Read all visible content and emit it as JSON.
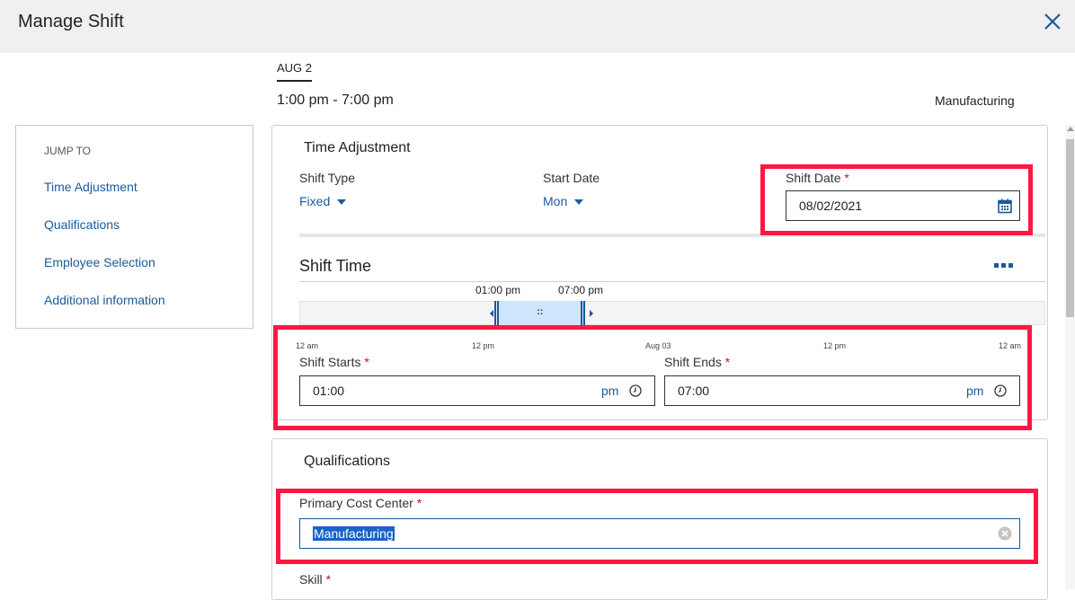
{
  "header": {
    "title": "Manage Shift",
    "close_icon": "close-icon"
  },
  "tab": {
    "date": "AUG 2"
  },
  "shift_summary": {
    "time_range": "1:00 pm - 7:00 pm",
    "cost_center": "Manufacturing"
  },
  "jump_to": {
    "heading": "JUMP TO",
    "links": [
      "Time Adjustment",
      "Qualifications",
      "Employee Selection",
      "Additional information"
    ]
  },
  "time_adjustment": {
    "title": "Time Adjustment",
    "shift_type": {
      "label": "Shift Type",
      "value": "Fixed"
    },
    "start_date": {
      "label": "Start Date",
      "value": "Mon"
    },
    "shift_date": {
      "label": "Shift Date",
      "required": "*",
      "value": "08/02/2021",
      "icon": "calendar-icon"
    }
  },
  "shift_time": {
    "title": "Shift Time",
    "menu_icon": "more-options-icon",
    "start_label": "01:00 pm",
    "end_label": "07:00 pm",
    "axis": [
      "12 am",
      "12 pm",
      "Aug 03",
      "12 pm",
      "12 am"
    ],
    "grip": "::",
    "shift_starts": {
      "label": "Shift Starts",
      "required": "*",
      "value": "01:00",
      "ampm": "pm",
      "icon": "clock-icon"
    },
    "shift_ends": {
      "label": "Shift Ends",
      "required": "*",
      "value": "07:00",
      "ampm": "pm",
      "icon": "clock-icon"
    }
  },
  "qualifications": {
    "title": "Qualifications",
    "primary_cost_center": {
      "label": "Primary Cost Center",
      "required": "*",
      "value": "Manufacturing",
      "clear_icon": "clear-icon"
    },
    "skill": {
      "label": "Skill",
      "required": "*"
    }
  },
  "colors": {
    "accent": "#1a5a9e",
    "highlight": "#ff1744",
    "required": "#c8102e",
    "selection": "#cde6fb",
    "header_bg": "#f0f0f0"
  }
}
